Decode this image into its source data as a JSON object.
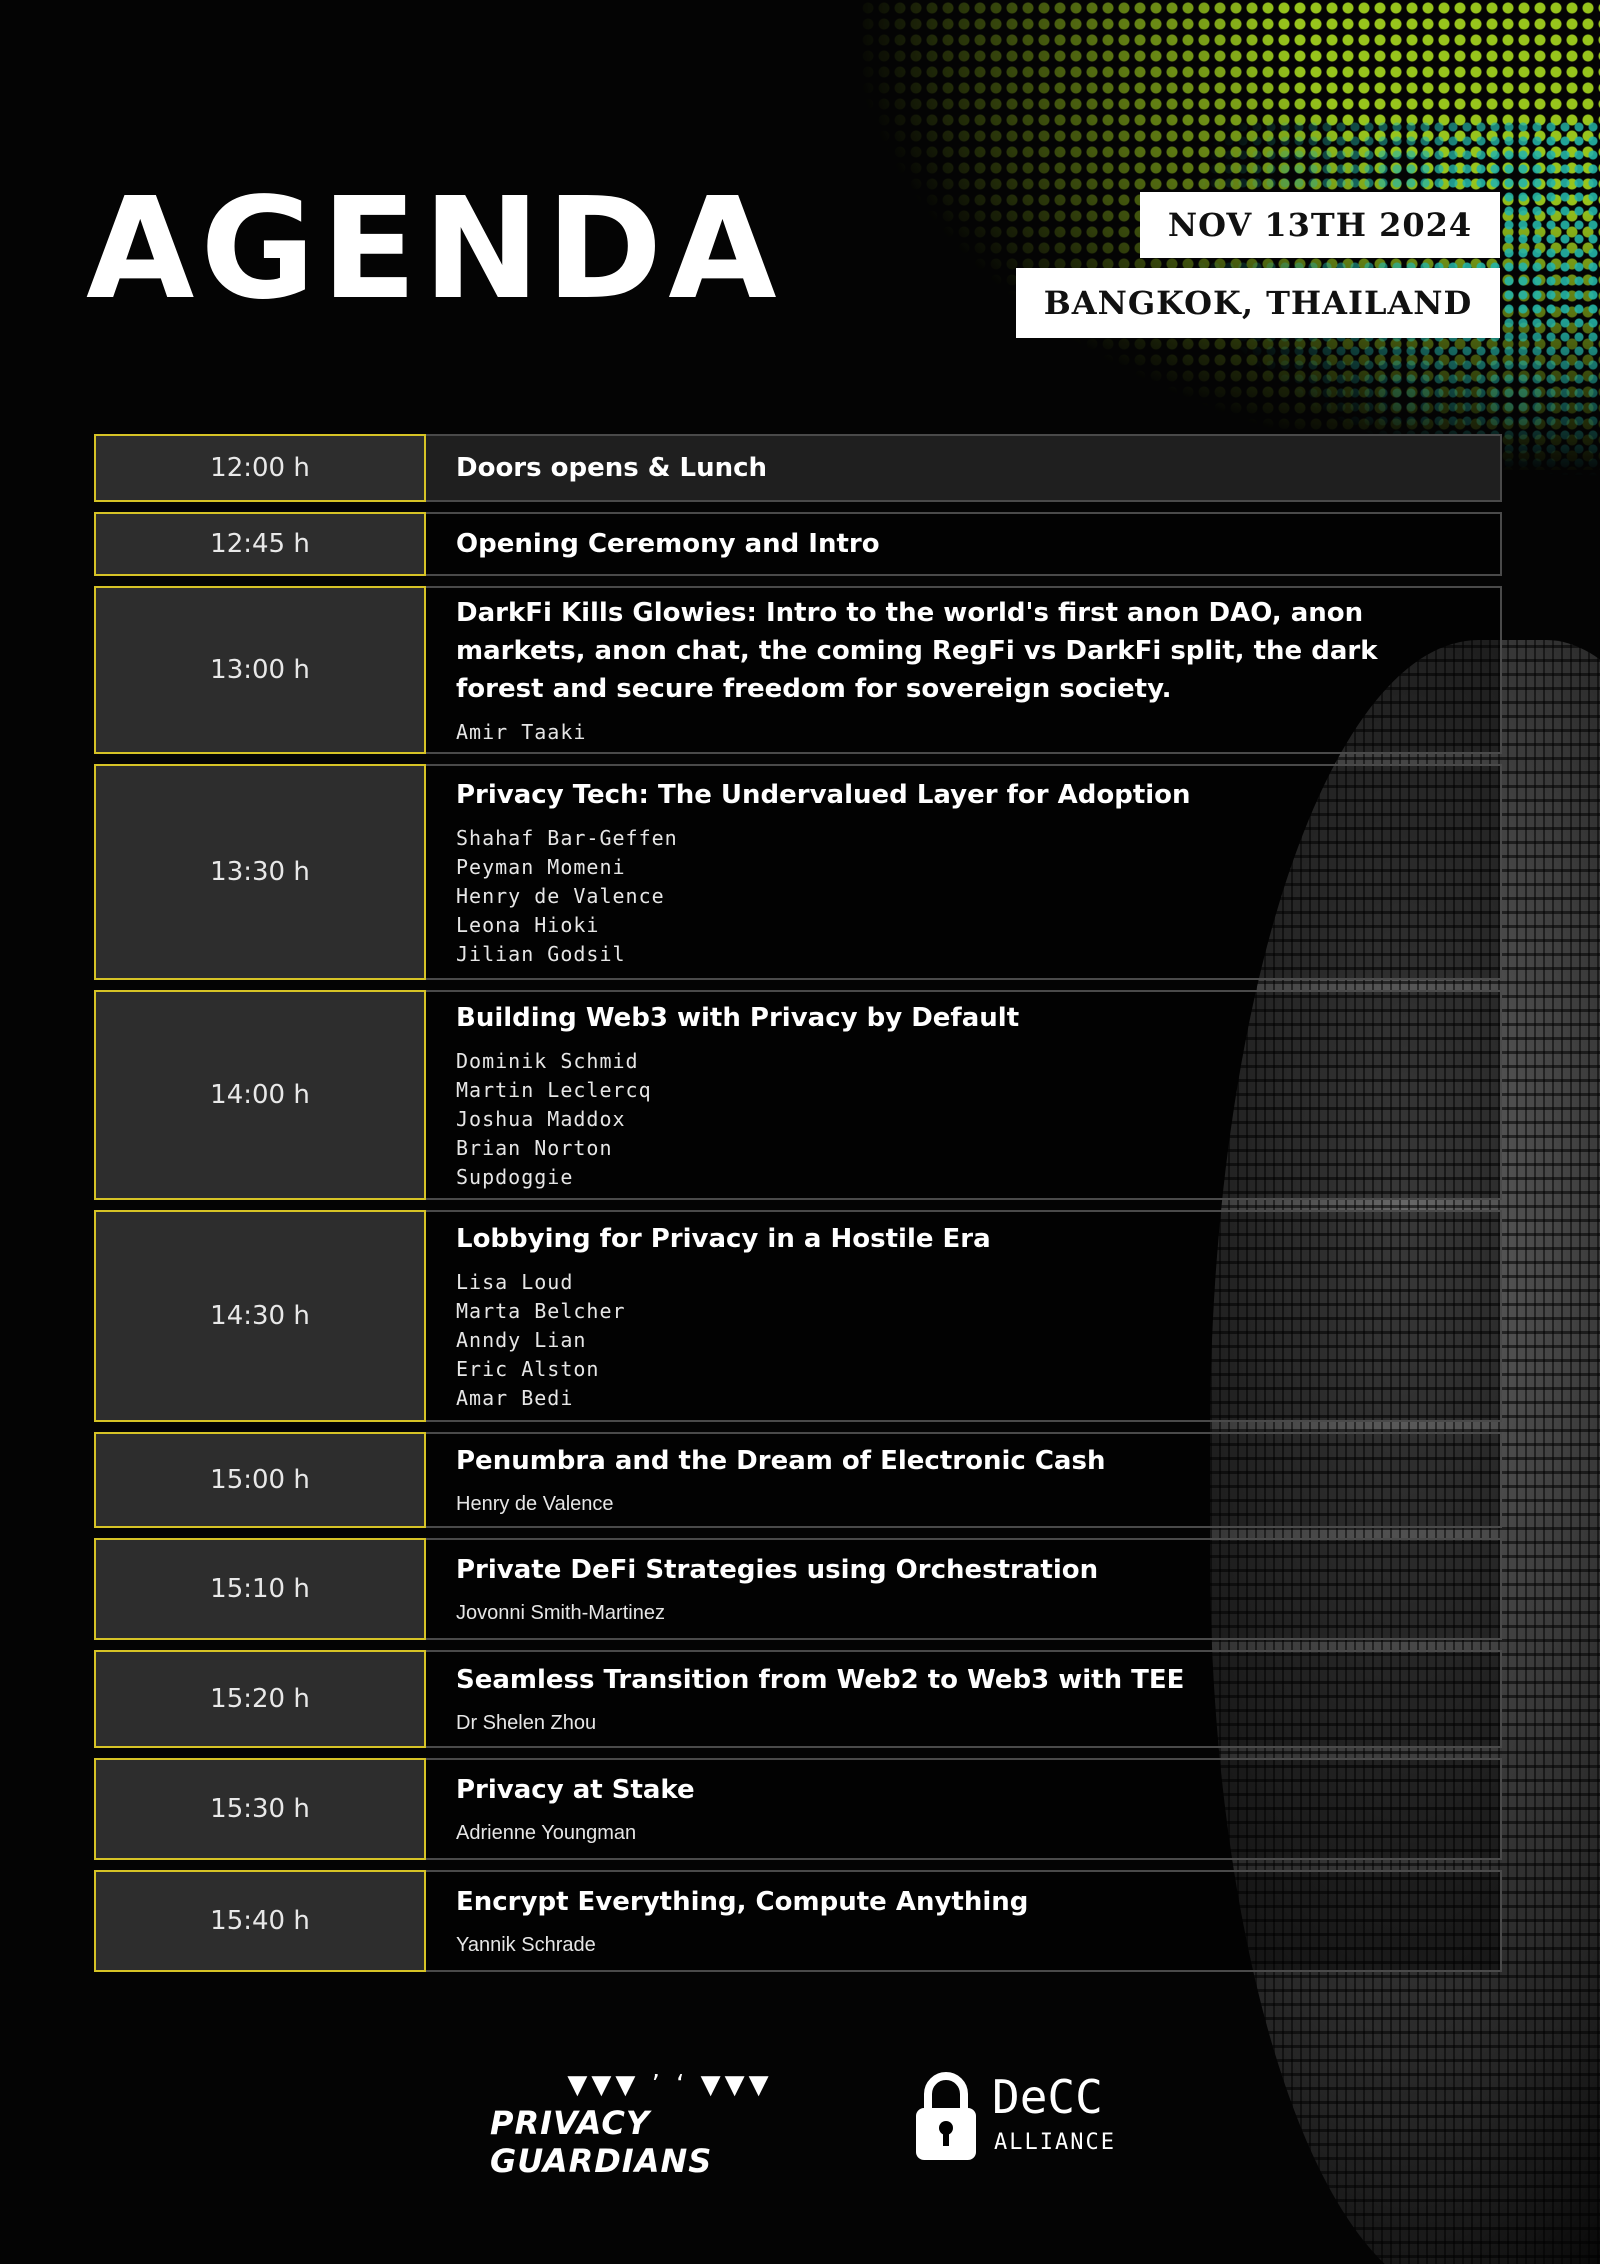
{
  "header": {
    "title": "AGENDA",
    "date": "NOV 13TH 2024",
    "location": "BANGKOK, THAILAND"
  },
  "sessions": [
    {
      "time": "12:00 h",
      "title": "Doors opens & Lunch",
      "speakers": []
    },
    {
      "time": "12:45 h",
      "title": "Opening Ceremony and Intro",
      "speakers": []
    },
    {
      "time": "13:00 h",
      "title": "DarkFi Kills Glowies: Intro to the world's first anon DAO, anon markets, anon chat, the coming RegFi vs DarkFi split, the dark forest and secure freedom for sovereign society.",
      "speakers": [
        "Amir Taaki"
      ]
    },
    {
      "time": "13:30 h",
      "title": "Privacy Tech: The Undervalued Layer for Adoption",
      "speakers": [
        "Shahaf Bar-Geffen",
        "Peyman Momeni",
        "Henry de Valence",
        "Leona Hioki",
        "Jilian Godsil"
      ]
    },
    {
      "time": "14:00 h",
      "title": "Building Web3 with Privacy by Default",
      "speakers": [
        "Dominik Schmid",
        "Martin Leclercq",
        "Joshua Maddox",
        "Brian Norton",
        "Supdoggie"
      ]
    },
    {
      "time": "14:30 h",
      "title": "Lobbying for Privacy in a Hostile Era",
      "speakers": [
        "Lisa Loud",
        "Marta Belcher",
        "Anndy Lian",
        "Eric Alston",
        "Amar Bedi"
      ]
    },
    {
      "time": "15:00 h",
      "title": "Penumbra and the Dream of Electronic Cash",
      "speakers": [
        "Henry de Valence"
      ]
    },
    {
      "time": "15:10 h",
      "title": "Private DeFi Strategies using Orchestration",
      "speakers": [
        "Jovonni Smith-Martinez"
      ]
    },
    {
      "time": "15:20 h",
      "title": "Seamless Transition from Web2 to Web3 with TEE",
      "speakers": [
        "Dr Shelen Zhou"
      ]
    },
    {
      "time": "15:30 h",
      "title": "Privacy at Stake",
      "speakers": [
        "Adrienne Youngman"
      ]
    },
    {
      "time": "15:40 h",
      "title": "Encrypt Everything, Compute Anything",
      "speakers": [
        "Yannik Schrade"
      ]
    }
  ],
  "logos": {
    "privacy_guardians": "PRIVACY GUARDIANS",
    "decc_name": "DeCC",
    "decc_sub": "ALLIANCE"
  },
  "colors": {
    "accent_border": "#d6c326",
    "halftone_green": "#9fcf1e",
    "halftone_teal": "#25b5a8"
  }
}
